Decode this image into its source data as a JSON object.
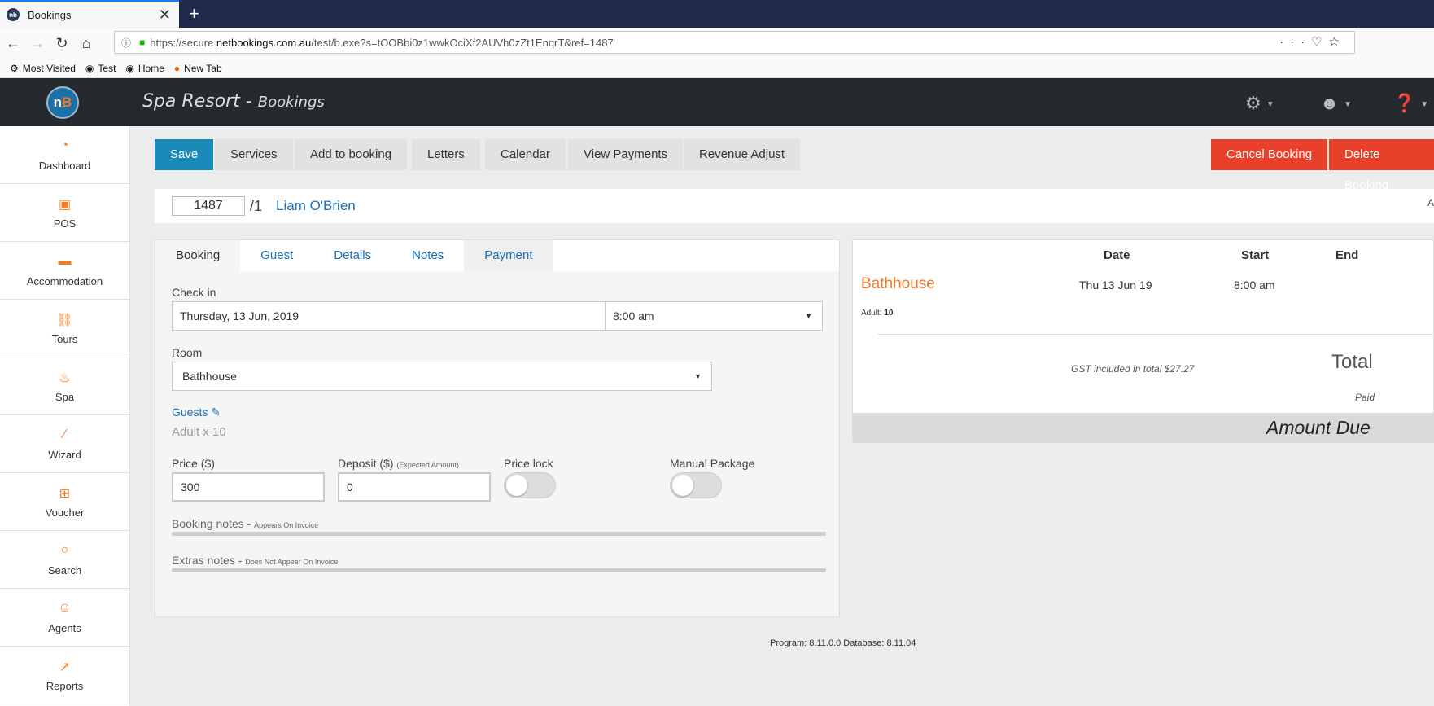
{
  "browser": {
    "tab_title": "Bookings",
    "url_prefix": "https://secure.",
    "url_domain": "netbookings.com.au",
    "url_path": "/test/b.exe?s=tOOBbi0z1wwkOciXf2AUVh0zZt1EnqrT&ref=1487",
    "bookmarks": [
      "Most Visited",
      "Test",
      "Home",
      "New Tab"
    ]
  },
  "header": {
    "title": "Spa Resort - ",
    "subtitle": "Bookings"
  },
  "sidebar": {
    "items": [
      {
        "label": "Dashboard",
        "icon": "dashboard-icon"
      },
      {
        "label": "POS",
        "icon": "pos-icon"
      },
      {
        "label": "Accommodation",
        "icon": "bed-icon"
      },
      {
        "label": "Tours",
        "icon": "tours-icon"
      },
      {
        "label": "Spa",
        "icon": "spa-icon"
      },
      {
        "label": "Wizard",
        "icon": "wand-icon"
      },
      {
        "label": "Voucher",
        "icon": "gift-icon"
      },
      {
        "label": "Search",
        "icon": "search-icon"
      },
      {
        "label": "Agents",
        "icon": "agent-icon"
      },
      {
        "label": "Reports",
        "icon": "chart-icon"
      }
    ]
  },
  "toolbar": {
    "save": "Save",
    "services": "Services",
    "add_to_booking": "Add to booking",
    "letters": "Letters",
    "calendar": "Calendar",
    "view_payments": "View Payments",
    "revenue_adjust": "Revenue Adjust",
    "cancel_booking": "Cancel Booking",
    "delete_booking": "Delete Booking"
  },
  "booking_id": {
    "number": "1487",
    "suffix": "/1",
    "guest_name": "Liam O'Brien",
    "right_edge_text": "A"
  },
  "tabs": [
    "Booking",
    "Guest",
    "Details",
    "Notes",
    "Payment"
  ],
  "form": {
    "check_in_label": "Check in",
    "check_in_date": "Thursday, 13 Jun, 2019",
    "check_in_time": "8:00 am",
    "room_label": "Room",
    "room_value": "Bathhouse",
    "guests_label": "Guests",
    "guests_value": "Adult x 10",
    "price_label": "Price ($)",
    "price_value": "300",
    "deposit_label": "Deposit ($)",
    "deposit_hint": "(Expected Amount)",
    "deposit_value": "0",
    "price_lock_label": "Price lock",
    "manual_package_label": "Manual Package",
    "booking_notes_label": "Booking notes - ",
    "booking_notes_hint": "Appears On Invoice",
    "extras_notes_label": "Extras notes - ",
    "extras_notes_hint": "Does Not Appear On Invoice"
  },
  "summary": {
    "col_date": "Date",
    "col_start": "Start",
    "col_end": "End",
    "item_name": "Bathhouse",
    "item_date": "Thu 13 Jun 19",
    "item_start": "8:00 am",
    "adult_label": "Adult:",
    "adult_count": "10",
    "gst_text": "GST included in total $27.27",
    "total_label": "Total",
    "paid_label": "Paid",
    "amount_due_label": "Amount Due"
  },
  "footer": "Program: 8.11.0.0 Database: 8.11.04",
  "colors": {
    "accent_blue": "#1a8ab8",
    "danger_red": "#e8402a",
    "brand_orange": "#f47a20"
  }
}
